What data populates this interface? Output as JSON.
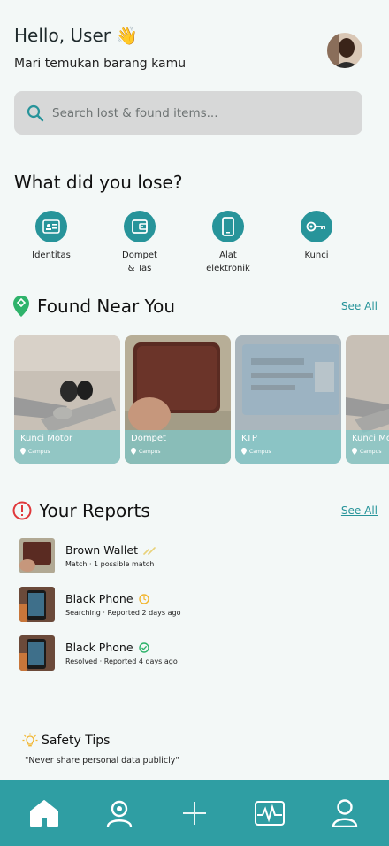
{
  "header": {
    "greeting": "Hello, User",
    "greeting_emoji": "👋",
    "subtitle": "Mari temukan barang kamu"
  },
  "search": {
    "placeholder": "Search lost & found items..."
  },
  "lose_section": {
    "title": "What did you lose?"
  },
  "categories": [
    {
      "label": "Identitas",
      "icon": "id-card-icon"
    },
    {
      "label": "Dompet\n& Tas",
      "icon": "wallet-icon"
    },
    {
      "label": "Alat\nelektronik",
      "icon": "phone-icon"
    },
    {
      "label": "Kunci",
      "icon": "key-icon"
    }
  ],
  "found_section": {
    "title": "Found Near You",
    "see_all": "See All"
  },
  "found_items": [
    {
      "name": "Kunci Motor",
      "location": "Campus"
    },
    {
      "name": "Dompet",
      "location": "Campus"
    },
    {
      "name": "KTP",
      "location": "Campus"
    },
    {
      "name": "Kunci Mo",
      "location": "Campus"
    }
  ],
  "reports_section": {
    "title": "Your Reports",
    "see_all": "See All"
  },
  "reports": [
    {
      "title": "Brown Wallet",
      "status": "Match · 1 possible match",
      "status_icon": "link-icon"
    },
    {
      "title": "Black Phone",
      "status": "Searching · Reported 2 days ago",
      "status_icon": "clock-icon"
    },
    {
      "title": "Black Phone",
      "status": "Resolved · Reported 4 days ago",
      "status_icon": "check-icon"
    }
  ],
  "tips": {
    "title": "Safety Tips",
    "text": "\"Never share personal data publicly\""
  },
  "nav": [
    "home-icon",
    "contacts-icon",
    "add-icon",
    "activity-icon",
    "profile-icon"
  ],
  "colors": {
    "accent": "#27949a",
    "navbar": "#2f9ea3",
    "background": "#f3f8f7"
  }
}
